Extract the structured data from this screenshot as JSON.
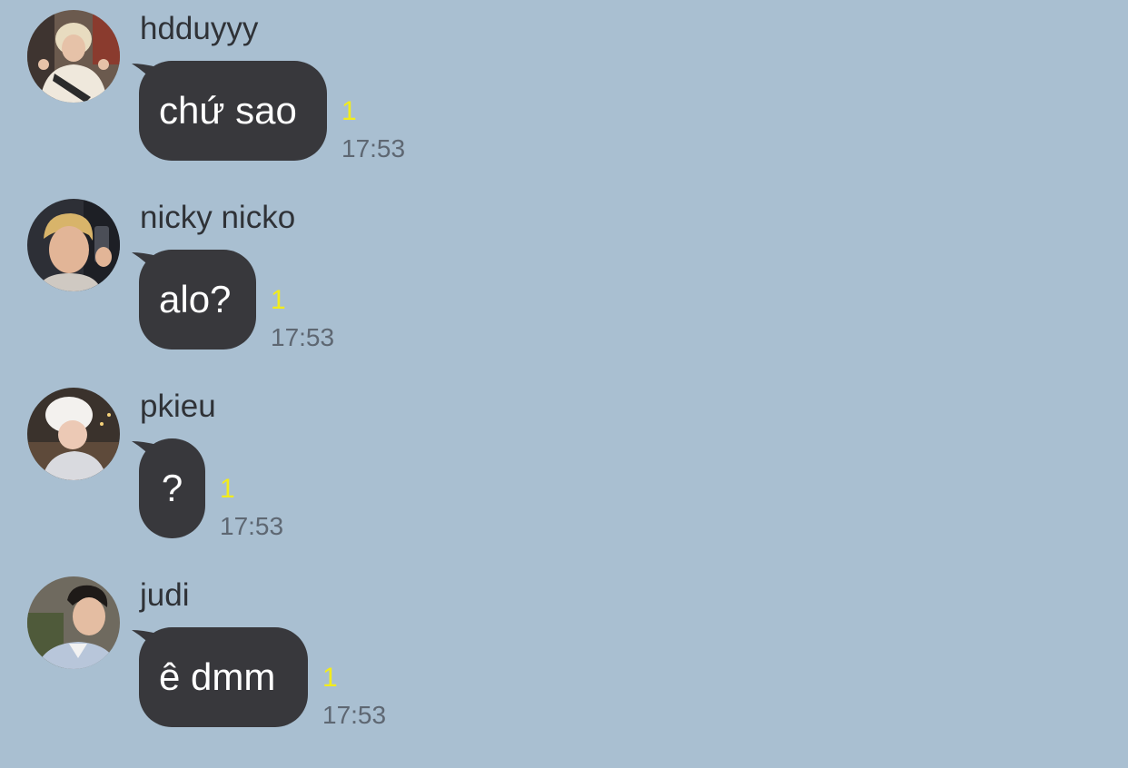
{
  "colors": {
    "background": "#a9bfd1",
    "bubble": "#38383c",
    "bubble_text": "#ffffff",
    "sender_text": "#2f3237",
    "unread": "#f2ec1c",
    "time": "#5e6772"
  },
  "messages": [
    {
      "sender": "hdduyyy",
      "text": "chứ sao",
      "unread": "1",
      "time": "17:53",
      "avatar": "user-photo-avatar"
    },
    {
      "sender": "nicky nicko",
      "text": "alo?",
      "unread": "1",
      "time": "17:53",
      "avatar": "user-photo-avatar"
    },
    {
      "sender": "pkieu",
      "text": "?",
      "unread": "1",
      "time": "17:53",
      "avatar": "user-photo-avatar"
    },
    {
      "sender": "judi",
      "text": "ê dmm",
      "unread": "1",
      "time": "17:53",
      "avatar": "user-photo-avatar"
    }
  ]
}
